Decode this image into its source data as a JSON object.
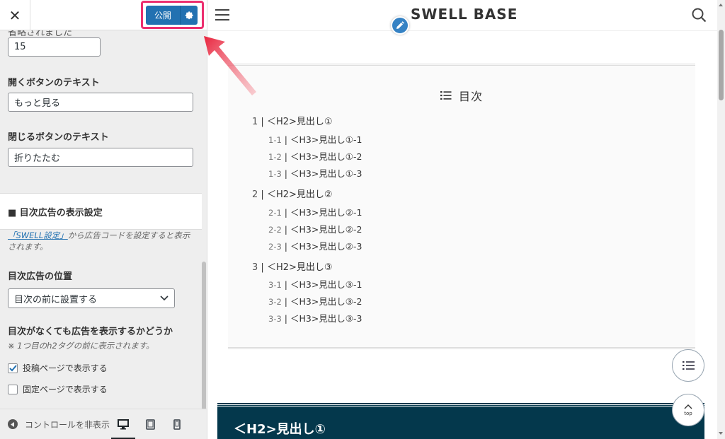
{
  "panel": {
    "close_glyph": "✕",
    "publish_label": "公開",
    "cut_label": "省略されました",
    "fields": {
      "count_value": "15",
      "open_label": "開くボタンのテキスト",
      "open_value": "もっと見る",
      "close_label": "閉じるボタンのテキスト",
      "close_value": "折りたたむ"
    },
    "section_title": "■ 目次広告の表示設定",
    "desc_link": "「SWELL設定」",
    "desc_text": "から広告コードを設定すると表示されます。",
    "position_label": "目次広告の位置",
    "position_value": "目次の前に設置する",
    "show_label": "目次がなくても広告を表示するかどうか",
    "show_note": "※ 1つ目のh2タグの前に表示されます。",
    "check_post": "投稿ページで表示する",
    "check_post_checked": true,
    "check_page": "固定ページで表示する",
    "check_page_checked": false,
    "hide_controls": "コントロールを非表示",
    "accent": "#2271b1",
    "highlight": "#ec2f6f"
  },
  "preview": {
    "site_title": "SWELL BASE",
    "toc_title": "目次",
    "toc": [
      {
        "num": "1",
        "text": "＜H2>見出し①",
        "children": [
          {
            "num": "1-1",
            "text": "＜H3>見出し①-1"
          },
          {
            "num": "1-2",
            "text": "＜H3>見出し①-2"
          },
          {
            "num": "1-3",
            "text": "＜H3>見出し①-3"
          }
        ]
      },
      {
        "num": "2",
        "text": "＜H2>見出し②",
        "children": [
          {
            "num": "2-1",
            "text": "＜H3>見出し②-1"
          },
          {
            "num": "2-2",
            "text": "＜H3>見出し②-2"
          },
          {
            "num": "2-3",
            "text": "＜H3>見出し②-3"
          }
        ]
      },
      {
        "num": "3",
        "text": "＜H2>見出し③",
        "children": [
          {
            "num": "3-1",
            "text": "＜H3>見出し③-1"
          },
          {
            "num": "3-2",
            "text": "＜H3>見出し③-2"
          },
          {
            "num": "3-3",
            "text": "＜H3>見出し③-3"
          }
        ]
      }
    ],
    "top_button_label": "top",
    "h2_heading": "＜H2>見出し①",
    "h2_bg": "#04384c"
  }
}
